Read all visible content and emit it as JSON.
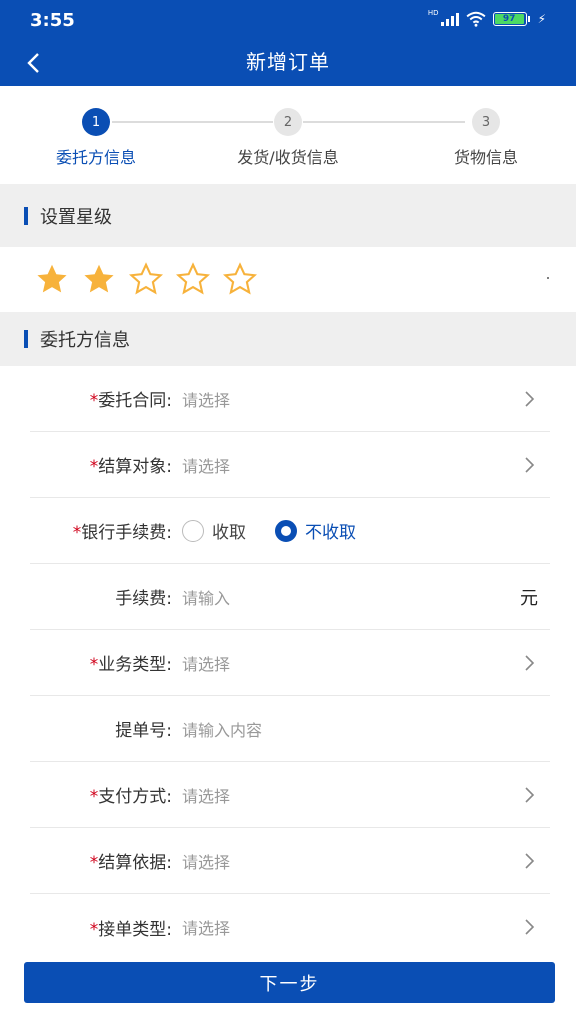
{
  "status_bar": {
    "time": "3:55",
    "hd": "HD",
    "battery": "97"
  },
  "header": {
    "title": "新增订单"
  },
  "stepper": [
    {
      "num": "1",
      "label": "委托方信息",
      "active": true
    },
    {
      "num": "2",
      "label": "发货/收货信息",
      "active": false
    },
    {
      "num": "3",
      "label": "货物信息",
      "active": false
    }
  ],
  "rating_section": {
    "title": "设置星级",
    "rating": 2,
    "max": 5
  },
  "client_section": {
    "title": "委托方信息"
  },
  "form": {
    "contract": {
      "required": "*",
      "label": "委托合同:",
      "placeholder": "请选择"
    },
    "settle_target": {
      "required": "*",
      "label": "结算对象:",
      "placeholder": "请选择"
    },
    "bank_fee": {
      "required": "*",
      "label": "银行手续费:",
      "option_charge": "收取",
      "option_nocharge": "不收取",
      "selected": "不收取"
    },
    "fee": {
      "label": "手续费:",
      "placeholder": "请输入",
      "unit": "元"
    },
    "biz_type": {
      "required": "*",
      "label": "业务类型:",
      "placeholder": "请选择"
    },
    "bill_no": {
      "label": "提单号:",
      "placeholder": "请输入内容"
    },
    "pay_method": {
      "required": "*",
      "label": "支付方式:",
      "placeholder": "请选择"
    },
    "settle_basis": {
      "required": "*",
      "label": "结算依据:",
      "placeholder": "请选择"
    },
    "order_type": {
      "required": "*",
      "label": "接单类型:",
      "placeholder": "请选择"
    }
  },
  "footer": {
    "next_label": "下一步"
  },
  "colors": {
    "primary": "#0a4eb4",
    "star": "#f7b23b",
    "required": "#d0021b"
  }
}
